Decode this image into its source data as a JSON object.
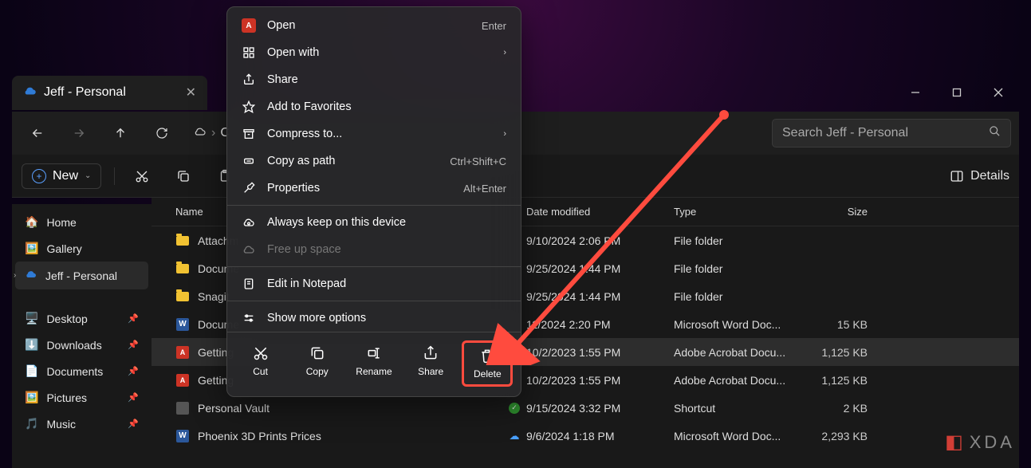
{
  "tab": {
    "title": "Jeff - Personal"
  },
  "window_controls": {
    "min": "−",
    "max": "▢",
    "close": "✕"
  },
  "nav": {
    "back": "←",
    "forward": "→",
    "up": "↑",
    "refresh": "⟳"
  },
  "address": {
    "cloud_icon": "cloud",
    "path_start": "C"
  },
  "search": {
    "placeholder": "Search Jeff - Personal"
  },
  "toolbar": {
    "new_label": "New",
    "more": "…",
    "details_label": "Details"
  },
  "sidebar": {
    "home": "Home",
    "gallery": "Gallery",
    "jeff": "Jeff - Personal",
    "desktop": "Desktop",
    "downloads": "Downloads",
    "documents": "Documents",
    "pictures": "Pictures",
    "music": "Music"
  },
  "columns": {
    "name": "Name",
    "date": "Date modified",
    "type": "Type",
    "size": "Size"
  },
  "files": [
    {
      "name": "Attachm",
      "date": "9/10/2024 2:06 PM",
      "type": "File folder",
      "size": "",
      "icon": "folder"
    },
    {
      "name": "Docume",
      "date": "9/25/2024 1:44 PM",
      "type": "File folder",
      "size": "",
      "icon": "folder"
    },
    {
      "name": "Snagit",
      "date": "9/25/2024 1:44 PM",
      "type": "File folder",
      "size": "",
      "icon": "folder"
    },
    {
      "name": "Docume",
      "date": "11/2024 2:20 PM",
      "type": "Microsoft Word Doc...",
      "size": "15 KB",
      "icon": "word"
    },
    {
      "name": "Getting",
      "date": "10/2/2023 1:55 PM",
      "type": "Adobe Acrobat Docu...",
      "size": "1,125 KB",
      "icon": "pdf",
      "selected": true
    },
    {
      "name": "Getting",
      "date": "10/2/2023 1:55 PM",
      "type": "Adobe Acrobat Docu...",
      "size": "1,125 KB",
      "icon": "pdf"
    },
    {
      "name": "Personal Vault",
      "date": "9/15/2024 3:32 PM",
      "type": "Shortcut",
      "size": "2 KB",
      "icon": "vault",
      "status": "green"
    },
    {
      "name": "Phoenix 3D Prints Prices",
      "date": "9/6/2024 1:18 PM",
      "type": "Microsoft Word Doc...",
      "size": "2,293 KB",
      "icon": "word",
      "status": "cloud"
    }
  ],
  "ctx": {
    "open": "Open",
    "open_kb": "Enter",
    "open_with": "Open with",
    "share": "Share",
    "favorites": "Add to Favorites",
    "compress": "Compress to...",
    "copy_path": "Copy as path",
    "copy_path_kb": "Ctrl+Shift+C",
    "properties": "Properties",
    "properties_kb": "Alt+Enter",
    "keep_device": "Always keep on this device",
    "free_space": "Free up space",
    "notepad": "Edit in Notepad",
    "show_more": "Show more options",
    "actions": {
      "cut": "Cut",
      "copy": "Copy",
      "rename": "Rename",
      "share": "Share",
      "delete": "Delete"
    }
  },
  "watermark": "XDA"
}
